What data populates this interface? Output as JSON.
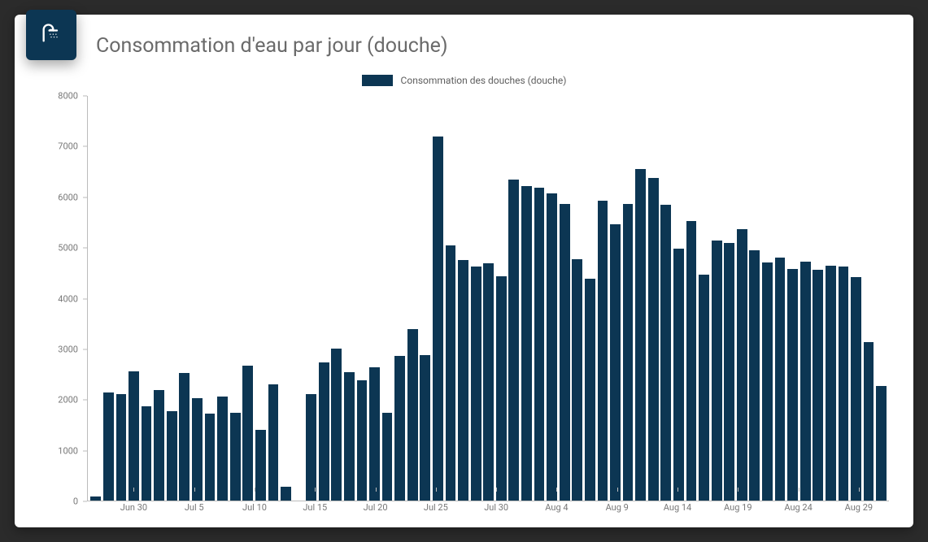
{
  "title": "Consommation d'eau par jour (douche)",
  "legend_label": "Consommation des douches (douche)",
  "colors": {
    "bar": "#0c3653",
    "card_bg": "#ffffff",
    "frame_bg": "#2b2b2b"
  },
  "chart_data": {
    "type": "bar",
    "ylabel": "",
    "xlabel": "",
    "ylim": [
      0,
      8000
    ],
    "y_ticks": [
      0,
      1000,
      2000,
      3000,
      4000,
      5000,
      6000,
      7000,
      8000
    ],
    "x_tick_labels": [
      "Jun 30",
      "Jul 5",
      "Jul 10",
      "Jul 15",
      "Jul 20",
      "Jul 25",
      "Jul 30",
      "Aug 4",
      "Aug 9",
      "Aug 14",
      "Aug 19",
      "Aug 24",
      "Aug 29"
    ],
    "x_tick_indices": [
      0,
      5,
      10,
      15,
      20,
      25,
      30,
      35,
      40,
      45,
      50,
      55,
      60
    ],
    "categories": [
      "Jun 30",
      "Jul 1",
      "Jul 2",
      "Jul 3",
      "Jul 4",
      "Jul 5",
      "Jul 6",
      "Jul 7",
      "Jul 8",
      "Jul 9",
      "Jul 10",
      "Jul 11",
      "Jul 12",
      "Jul 13",
      "Jul 14",
      "Jul 15",
      "Jul 16",
      "Jul 17",
      "Jul 18",
      "Jul 19",
      "Jul 20",
      "Jul 21",
      "Jul 22",
      "Jul 23",
      "Jul 24",
      "Jul 25",
      "Jul 26",
      "Jul 27",
      "Jul 28",
      "Jul 29",
      "Jul 30",
      "Jul 31",
      "Aug 1",
      "Aug 2",
      "Aug 3",
      "Aug 4",
      "Aug 5",
      "Aug 6",
      "Aug 7",
      "Aug 8",
      "Aug 9",
      "Aug 10",
      "Aug 11",
      "Aug 12",
      "Aug 13",
      "Aug 14",
      "Aug 15",
      "Aug 16",
      "Aug 17",
      "Aug 18",
      "Aug 19",
      "Aug 20",
      "Aug 21",
      "Aug 22",
      "Aug 23",
      "Aug 24",
      "Aug 25",
      "Aug 26",
      "Aug 27",
      "Aug 28",
      "Aug 29",
      "Aug 30"
    ],
    "values": [
      80,
      2130,
      2110,
      2560,
      1870,
      2190,
      1770,
      2520,
      2030,
      1720,
      2060,
      1740,
      2670,
      1400,
      2290,
      280,
      0,
      2110,
      2730,
      3010,
      2540,
      2380,
      2640,
      1740,
      2860,
      3390,
      2870,
      7200,
      5050,
      4750,
      4620,
      4690,
      4440,
      6340,
      6220,
      6190,
      6080,
      5870,
      4770,
      4380,
      5920,
      5460,
      5870,
      6550,
      6370,
      5840,
      4980,
      5520,
      4470,
      5140,
      5100,
      5370,
      4950,
      4700,
      4800,
      4580,
      4720,
      4570,
      4650,
      4620,
      4420,
      3140,
      2260
    ]
  }
}
